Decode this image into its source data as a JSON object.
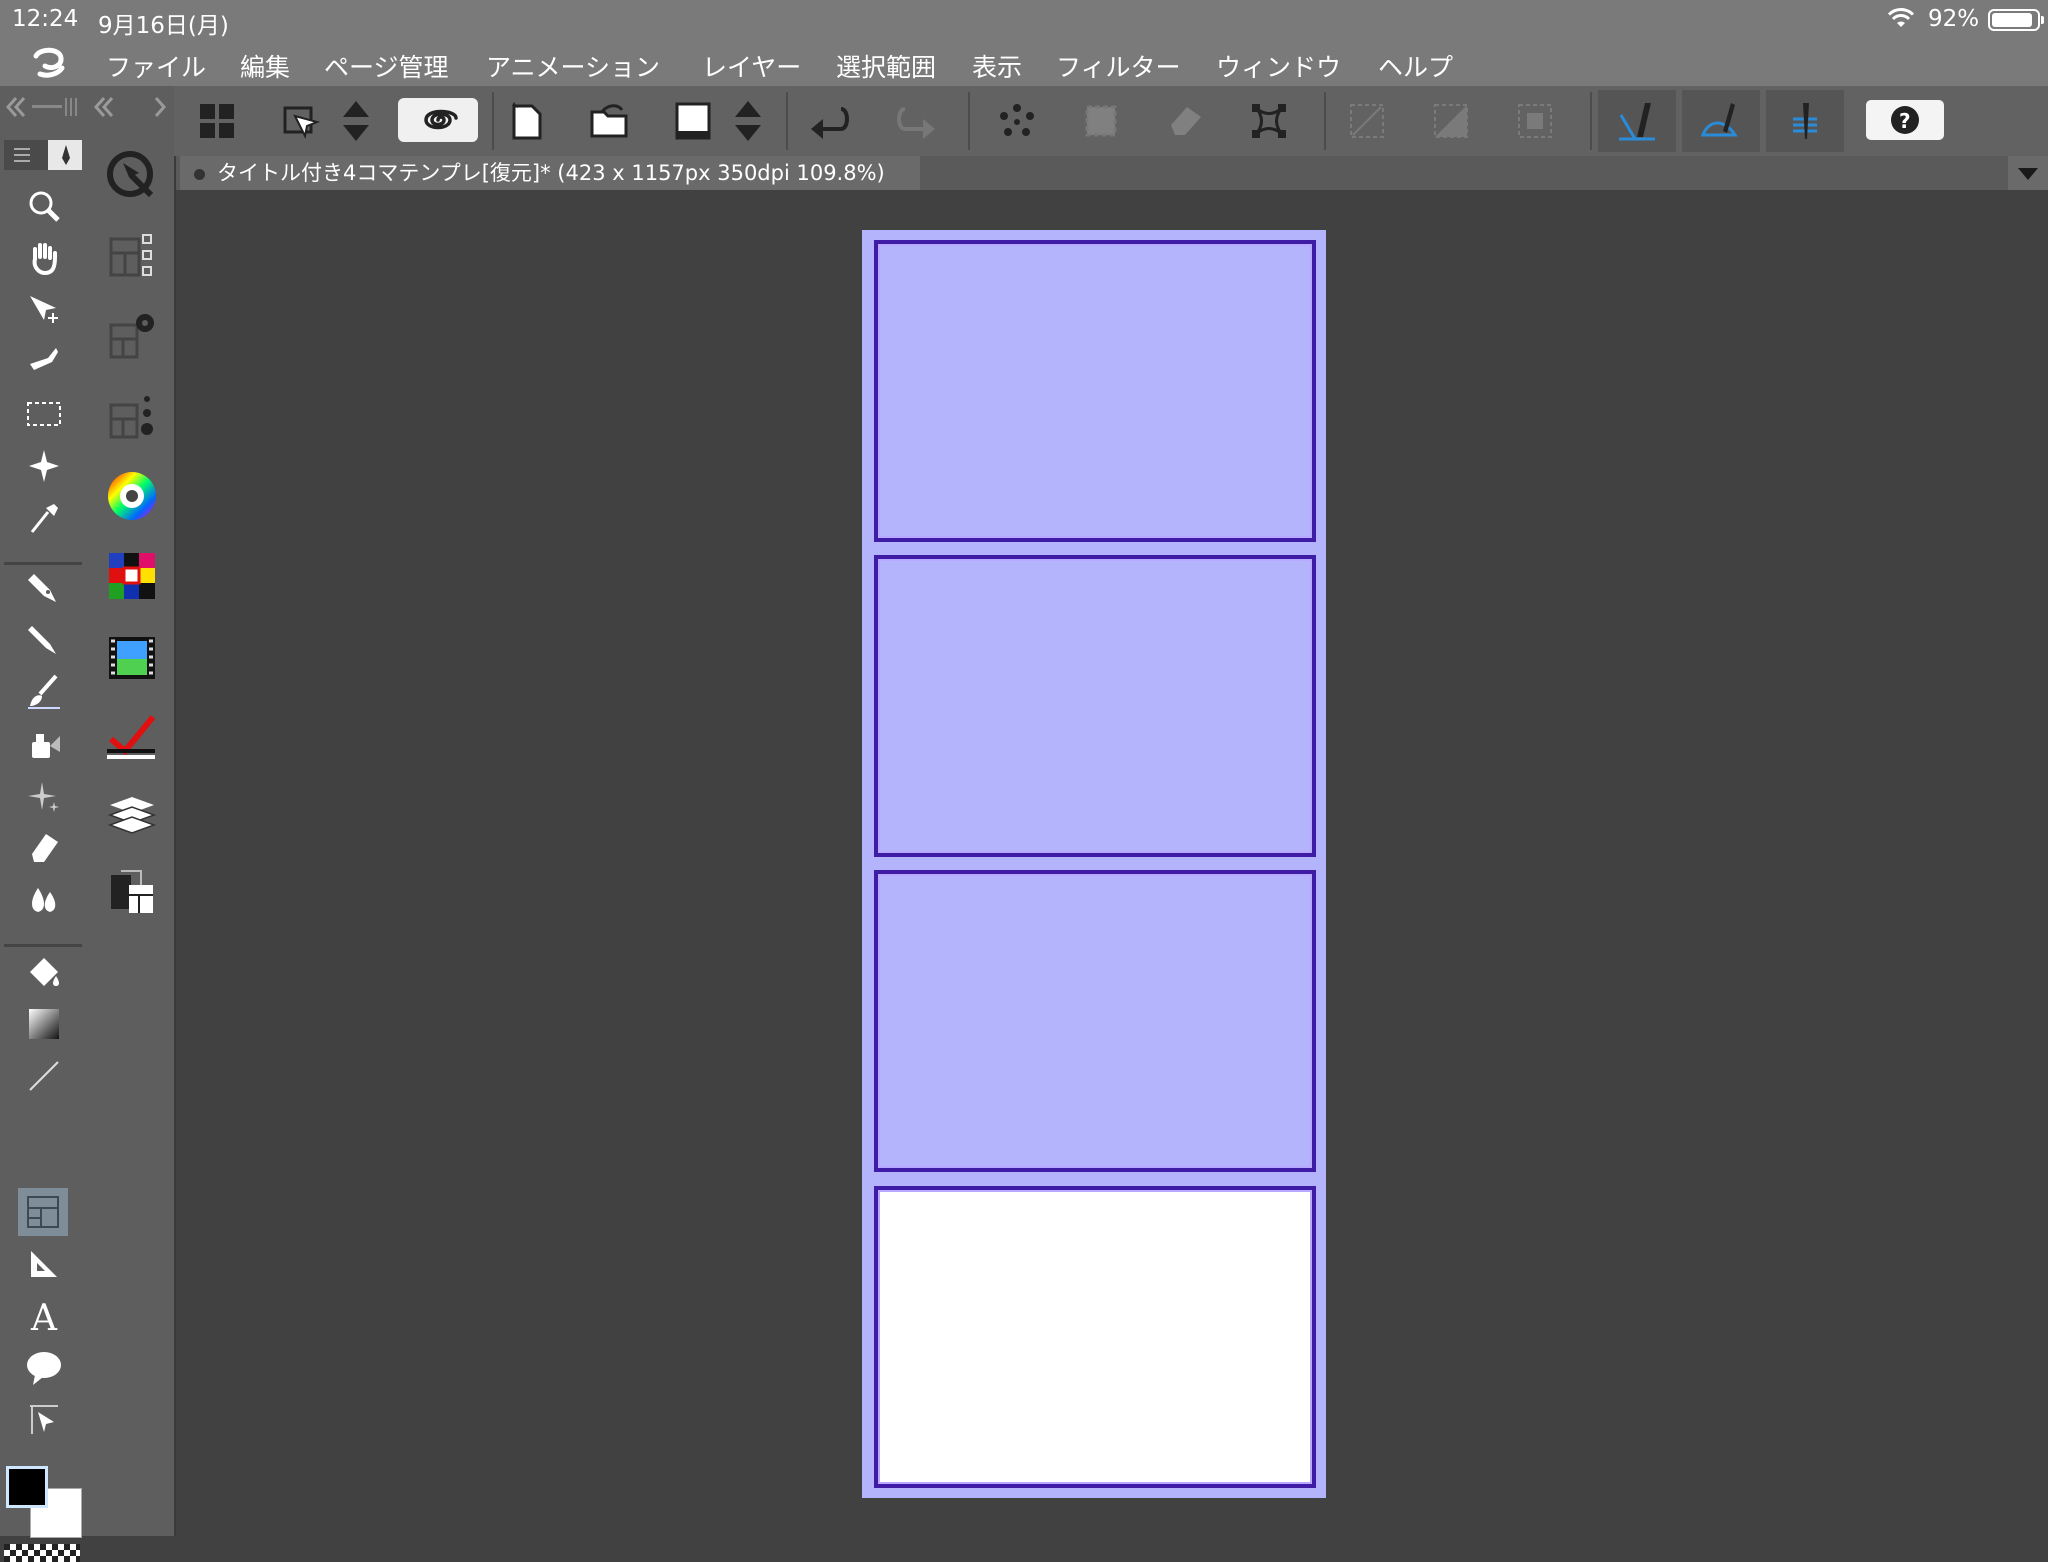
{
  "status_bar": {
    "time": "12:24",
    "date": "9月16日(月)",
    "battery_percent": "92%",
    "battery_level": 0.92
  },
  "menu": {
    "items": [
      "ファイル",
      "編集",
      "ページ管理",
      "アニメーション",
      "レイヤー",
      "選択範囲",
      "表示",
      "フィルター",
      "ウィンドウ",
      "ヘルプ"
    ]
  },
  "document": {
    "tab_title": "タイトル付き4コマテンプレ[復元]* (423 x 1157px 350dpi 109.8%)"
  },
  "colors": {
    "panel_fill": "#b4b4fc",
    "panel_border": "#3e1ca6",
    "canvas_bg": "#414141",
    "main_color": "#000000",
    "sub_color": "#ffffff"
  },
  "toolbar_icons": [
    "layout-grid-icon",
    "transform-icon",
    "updown-icon",
    "spiral-icon",
    "new-file-icon",
    "open-folder-icon",
    "save-icon",
    "updown-icon",
    "undo-icon",
    "redo-icon",
    "dots-icon",
    "clear-selection-icon",
    "erase-icon",
    "transform-handles-icon",
    "disabled-1-icon",
    "disabled-2-icon",
    "disabled-3-icon",
    "ruler-snap-1-icon",
    "ruler-snap-2-icon",
    "ruler-snap-3-icon",
    "help-icon"
  ],
  "tool_icons": [
    "zoom-icon",
    "hand-icon",
    "move-icon",
    "operation-icon",
    "rect-select-icon",
    "magic-wand-icon",
    "eyedropper-icon",
    "pen-icon",
    "pencil-icon",
    "brush-icon",
    "airbrush-icon",
    "sparkle-icon",
    "eraser-icon",
    "blend-icon",
    "fill-bucket-icon",
    "gradient-icon",
    "line-icon",
    "frame-icon",
    "ruler-icon",
    "text-icon",
    "balloon-icon",
    "correct-line-icon"
  ]
}
